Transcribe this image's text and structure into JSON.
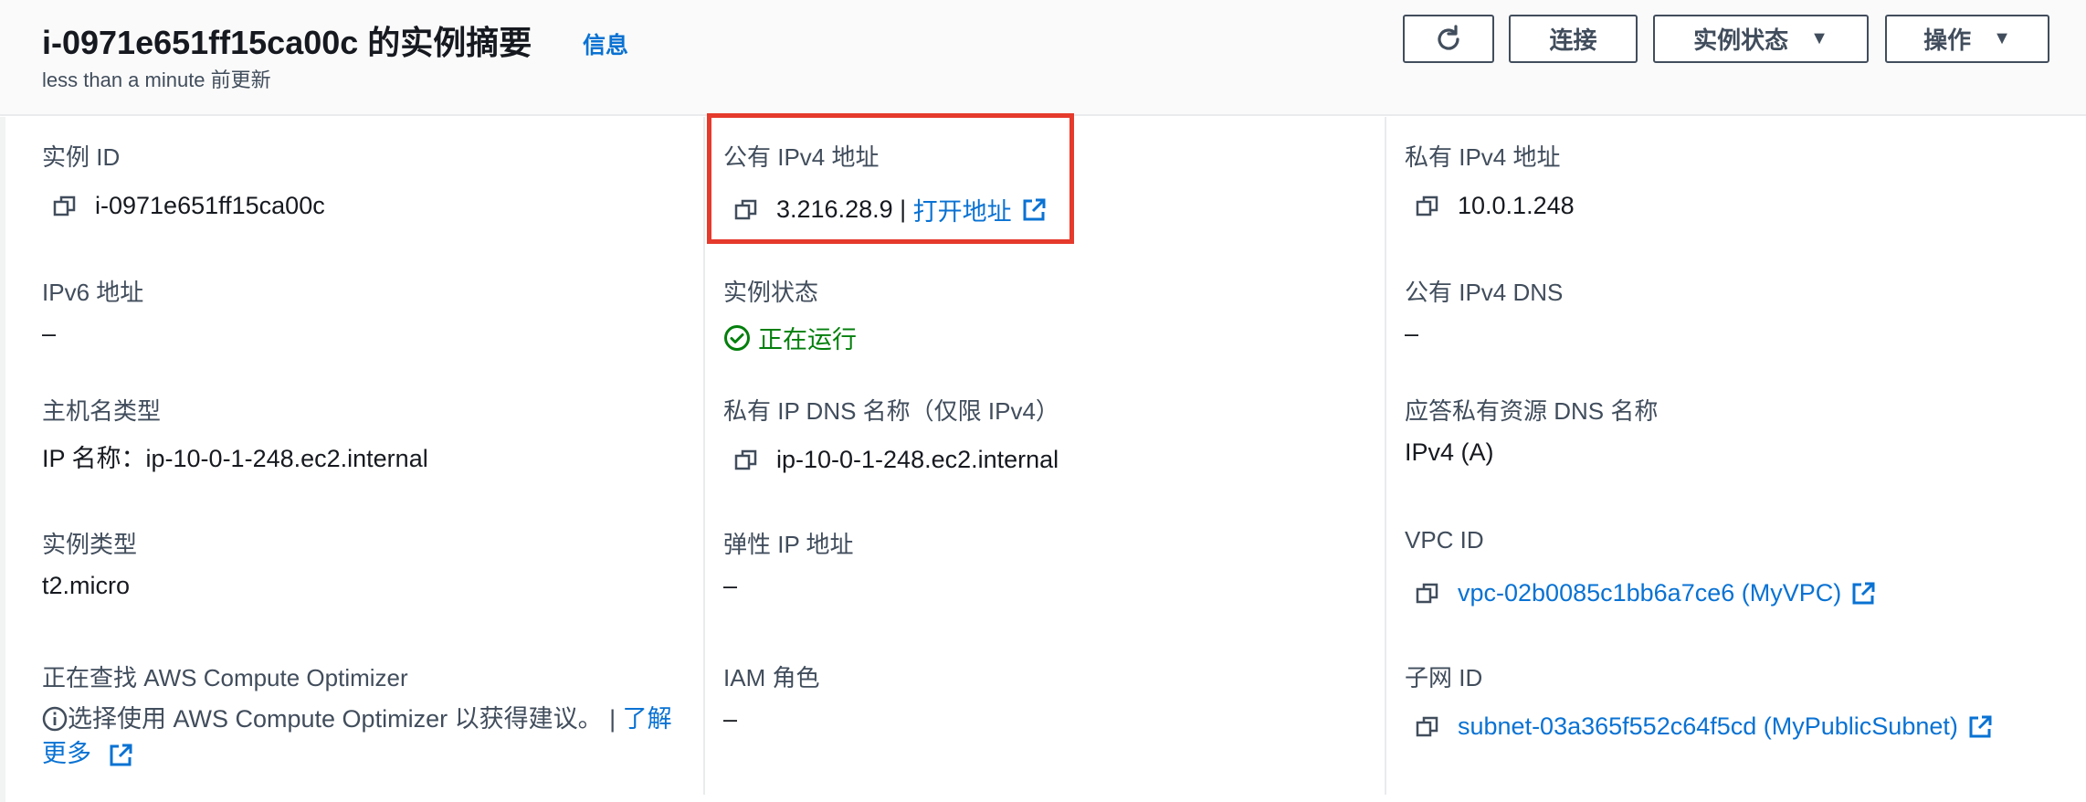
{
  "header": {
    "title": "i-0971e651ff15ca00c 的实例摘要",
    "info": "信息",
    "updated": "less than a minute 前更新",
    "buttons": {
      "refresh_icon": "refresh-icon",
      "connect": "连接",
      "instance_state": "实例状态",
      "actions": "操作"
    }
  },
  "fields": {
    "instance_id": {
      "label": "实例 ID",
      "value": "i-0971e651ff15ca00c"
    },
    "public_ipv4": {
      "label": "公有 IPv4 地址",
      "value": "3.216.28.9",
      "separator": " | ",
      "open_link": "打开地址"
    },
    "private_ipv4": {
      "label": "私有 IPv4 地址",
      "value": "10.0.1.248"
    },
    "ipv6": {
      "label": "IPv6 地址",
      "value": "–"
    },
    "instance_state": {
      "label": "实例状态",
      "value": "正在运行"
    },
    "public_dns": {
      "label": "公有 IPv4 DNS",
      "value": "–"
    },
    "hostname_type": {
      "label": "主机名类型",
      "value": "IP 名称：ip-10-0-1-248.ec2.internal"
    },
    "private_dns": {
      "label": "私有 IP DNS 名称（仅限 IPv4）",
      "value": "ip-10-0-1-248.ec2.internal"
    },
    "answer_dns": {
      "label": "应答私有资源 DNS 名称",
      "value": "IPv4 (A)"
    },
    "instance_type": {
      "label": "实例类型",
      "value": "t2.micro"
    },
    "elastic_ip": {
      "label": "弹性 IP 地址",
      "value": "–"
    },
    "vpc_id": {
      "label": "VPC ID",
      "value": "vpc-02b0085c1bb6a7ce6 (MyVPC)"
    },
    "optimizer": {
      "label": "正在查找 AWS Compute Optimizer",
      "text": "选择使用 AWS Compute Optimizer 以获得建议。",
      "separator": " | ",
      "link": "了解更多"
    },
    "iam_role": {
      "label": "IAM 角色",
      "value": "–"
    },
    "subnet_id": {
      "label": "子网 ID",
      "value": "subnet-03a365f552c64f5cd (MyPublicSubnet)"
    }
  },
  "colors": {
    "link": "#0972d3",
    "status_running": "#037f0c",
    "highlight_box": "#e53a2c",
    "label": "#414d5c"
  }
}
